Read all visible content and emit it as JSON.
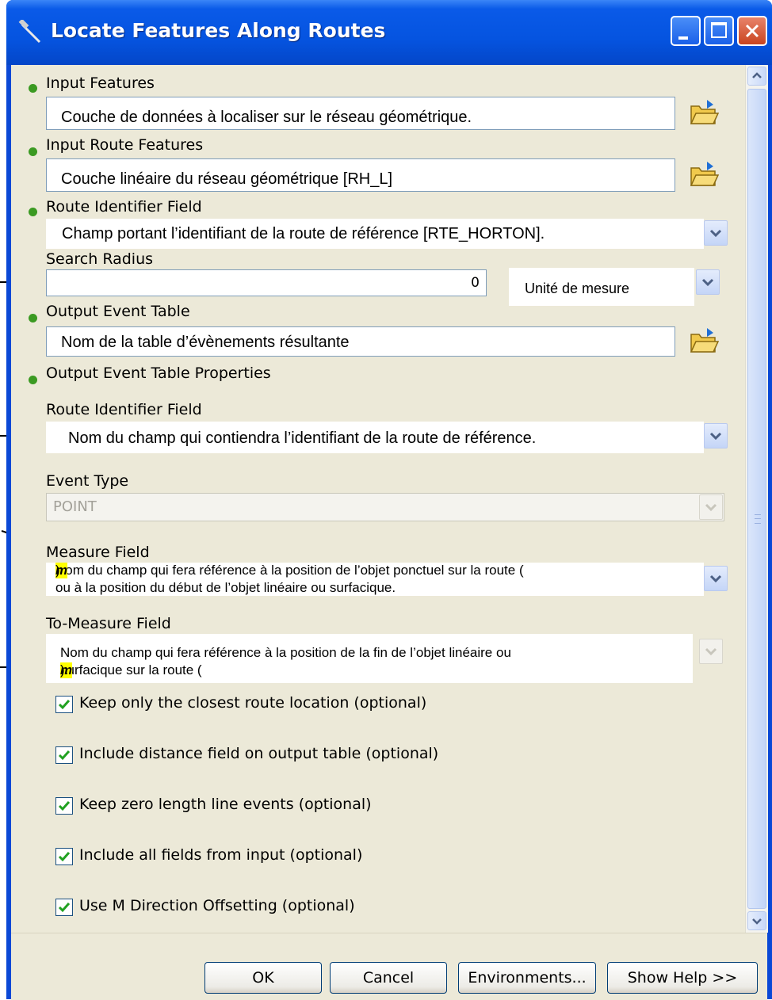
{
  "window": {
    "title": "Locate Features Along Routes"
  },
  "fields": {
    "input_features": {
      "label": "Input Features",
      "value": "Couche de données à localiser sur le réseau géométrique."
    },
    "input_route_features": {
      "label": "Input Route Features",
      "value": "Couche linéaire du réseau géométrique [RH_L]"
    },
    "route_identifier_field": {
      "label": "Route Identifier Field",
      "value": "Champ portant l’identifiant de la route de référence [RTE_HORTON]."
    },
    "search_radius": {
      "label": "Search Radius",
      "value": "0",
      "unit": "Unité de mesure"
    },
    "output_event_table": {
      "label": "Output Event Table",
      "value": "Nom de la table d’évènements résultante"
    },
    "output_event_table_properties": {
      "label": "Output Event Table Properties"
    },
    "event_route_identifier_field": {
      "label": "Route Identifier Field",
      "value": "Nom du champ qui contiendra l’identifiant de la route de référence."
    },
    "event_type": {
      "label": "Event Type",
      "value": "POINT"
    },
    "measure_field": {
      "label": "Measure Field",
      "line1_pre": "Nom du champ qui fera référence à la position de l’objet ponctuel sur la route (",
      "line1_m": "m",
      "line1_post": ")",
      "line2": "ou à la position du début de l’objet linéaire ou surfacique."
    },
    "to_measure_field": {
      "label": "To-Measure Field",
      "line1": "Nom du champ qui fera référence à la position de la fin de l’objet linéaire ou",
      "line2_pre": "surfacique sur la route (",
      "line2_m": "m",
      "line2_post": ")."
    }
  },
  "options": [
    {
      "label": "Keep only the closest route location (optional)",
      "checked": true
    },
    {
      "label": "Include distance field on output table (optional)",
      "checked": true
    },
    {
      "label": "Keep zero length line events (optional)",
      "checked": true
    },
    {
      "label": "Include all fields from input (optional)",
      "checked": true
    },
    {
      "label": "Use M Direction Offsetting (optional)",
      "checked": true
    }
  ],
  "buttons": {
    "ok": "OK",
    "cancel": "Cancel",
    "environments": "Environments...",
    "show_help": "Show Help >>"
  },
  "icons": {
    "title": "hammer-icon",
    "browse": "folder-open-icon",
    "dropdown": "chevron-down-icon",
    "check": "checkmark-icon",
    "required": "green-dot-icon"
  },
  "colors": {
    "titlebar": "#0554e0",
    "frame": "#0a48d6",
    "dialog_bg": "#ece9d8",
    "close": "#c9441f",
    "required_dot": "#3b9a22",
    "highlight": "#ffff00"
  }
}
